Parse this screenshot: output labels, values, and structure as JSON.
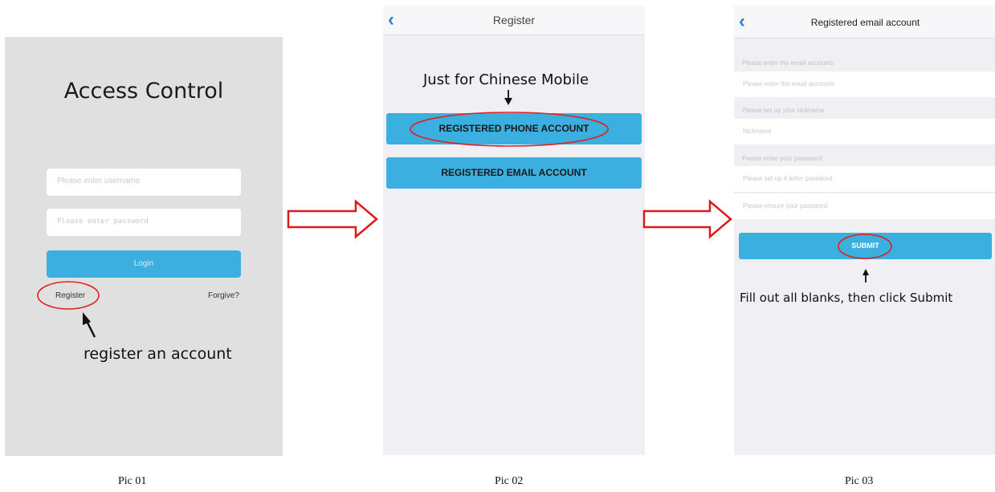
{
  "pic1": {
    "app_title": "Access Control",
    "username_placeholder": "Please enter username",
    "password_placeholder": "Please enter password",
    "login_label": "Login",
    "register_label": "Register",
    "forgive_label": "Forgive?",
    "annotation": "register an account",
    "caption": "Pic 01"
  },
  "pic2": {
    "nav_title": "Register",
    "back_icon": "chevron-left-icon",
    "annotation": "Just for Chinese Mobile",
    "phone_button": "REGISTERED PHONE ACCOUNT",
    "email_button": "REGISTERED EMAIL ACCOUNT",
    "caption": "Pic 02"
  },
  "pic3": {
    "nav_title": "Registered email account",
    "back_icon": "chevron-left-icon",
    "email_label": "Please enter the email accounts",
    "email_placeholder": "Please enter the email accounts",
    "nickname_label": "Please set up your nickname",
    "nickname_placeholder": "Nickname",
    "password_label": "Pealse enter your password",
    "password_placeholder": "Please set up 6 letter password",
    "confirm_placeholder": "Please ensure your password",
    "submit_label": "SUBMIT",
    "annotation": "Fill out all blanks, then click Submit",
    "caption": "Pic 03"
  },
  "colors": {
    "accent": "#3bb0e0",
    "highlight": "#e02020",
    "arrow": "#e01818"
  }
}
